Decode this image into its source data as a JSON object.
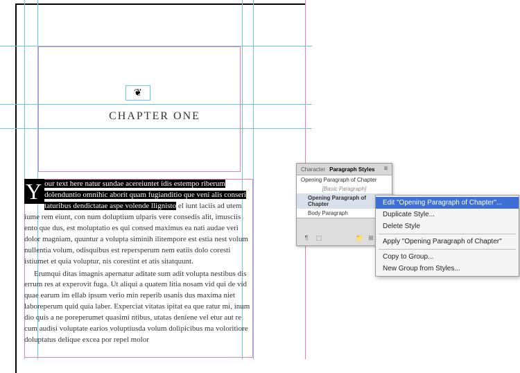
{
  "document": {
    "chapter_ornament": "❦",
    "chapter_title": "CHAPTER ONE",
    "highlight_text": "our text here natur sundae acereiuntet idis estempo riberum dolenduntio omnihic aborit quam fugianditio que veni alis conseri taturibus dendictatae aspe volende llignisto",
    "post_highlight": " el iunt laciis ad utem iume rem eiunt, con num doluptium ulparis vere consedis alit, imusciis ento que dus, est moluptatio es qui consed maximus ea nati audae veri dolor magniam, quuntur a volupta siminih ilitempore est estia nest volum nullentia volum, odisquibus est repersperum nem eatiis dolo coresti istiumet et quia voluptur, nis corestint et atis sitatquunt.",
    "para2": "Erumqui ditas imagnis apernatur aditate sum adit volupta nestibus dis errum res at experovit fuga. Ut aliqui a quatem litia nosam vid qui de vid quae earum im ellab ipsum verio min reperib usanis dus maxima niet laboreperum quid quia laber. Experciat vitatas ipitat ea que ratur mi, inum dio quis a ne poreperumet quasimi ntibus, utatas deniene vel etur aut re cum audisi voluptate earios voluptiusda volum dolipicibus ma voloritiore doluptatus delique excea por repel molor"
  },
  "panel": {
    "tab_character": "Character",
    "tab_pstyles": "Paragraph Styles",
    "items": {
      "i0": "Opening Paragraph of Chapter",
      "i1": "[Basic Paragraph]",
      "i2": "Opening Paragraph of Chapter",
      "i3": "Body Paragraph"
    }
  },
  "context_menu": {
    "m0": "Edit \"Opening Paragraph of Chapter\"...",
    "m1": "Duplicate Style...",
    "m2": "Delete Style",
    "m3": "Apply \"Opening Paragraph of Chapter\"",
    "m4": "Copy to Group...",
    "m5": "New Group from Styles..."
  }
}
